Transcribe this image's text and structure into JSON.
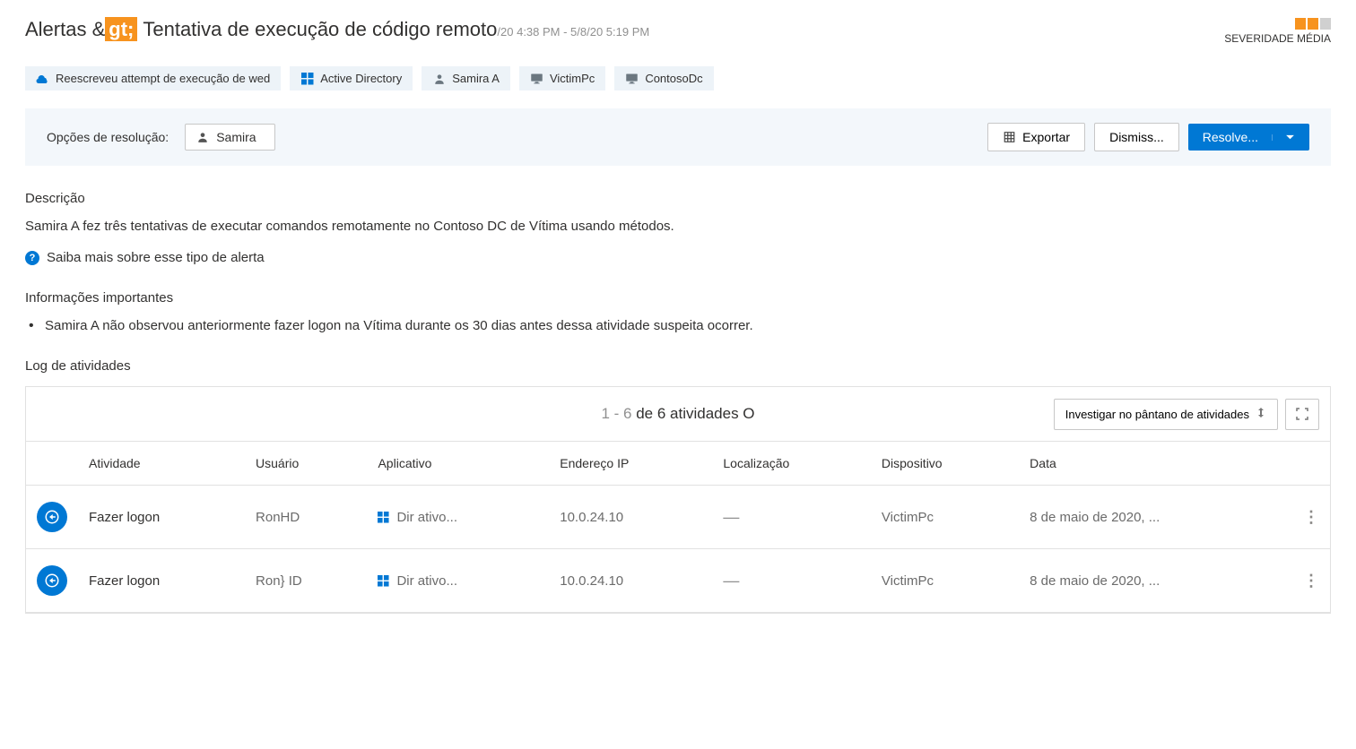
{
  "header": {
    "breadcrumb_prefix": "Alertas &",
    "breadcrumb_gt": "gt;",
    "title": "Tentativa de execução de código remoto",
    "date_range": "/20 4:38 PM - 5/8/20 5:19 PM"
  },
  "severity": {
    "label": "SEVERIDADE MÉDIA"
  },
  "chips": [
    {
      "label": "Reescreveu attempt de execução de wed",
      "icon": "cloud"
    },
    {
      "label": "Active Directory",
      "icon": "windows"
    },
    {
      "label": "Samira A",
      "icon": "person"
    },
    {
      "label": "VictimPc",
      "icon": "monitor"
    },
    {
      "label": "ContosoDc",
      "icon": "monitor"
    }
  ],
  "resolution": {
    "label": "Opções de resolução:",
    "user": "Samira",
    "export": "Exportar",
    "dismiss": "Dismiss...",
    "resolve": "Resolve..."
  },
  "description": {
    "title": "Descrição",
    "text": "Samira A fez três tentativas de executar comandos remotamente no Contoso DC de Vítima usando métodos.",
    "learn_more": "Saiba mais sobre esse tipo de alerta"
  },
  "important": {
    "title": "Informações importantes",
    "items": [
      "Samira A não observou anteriormente fazer logon na Vítima durante os 30 dias antes dessa atividade suspeita ocorrer."
    ]
  },
  "activity": {
    "title": "Log de atividades",
    "range": "1 - 6",
    "of_text": " de 6 atividades O",
    "investigate": "Investigar no pântano de atividades",
    "columns": {
      "activity": "Atividade",
      "user": "Usuário",
      "app": "Aplicativo",
      "ip": "Endereço IP",
      "location": "Localização",
      "device": "Dispositivo",
      "date": "Data"
    },
    "rows": [
      {
        "activity": "Fazer logon",
        "user": "RonHD",
        "app": "Dir ativo...",
        "ip": "10.0.24.10",
        "location": "—",
        "device": "VictimPc",
        "date": "8 de maio de 2020, ..."
      },
      {
        "activity": "Fazer logon",
        "user": "Ron} ID",
        "app": "Dir ativo...",
        "ip": "10.0.24.10",
        "location": "—",
        "device": "VictimPc",
        "date": "8 de maio de 2020, ..."
      }
    ]
  }
}
